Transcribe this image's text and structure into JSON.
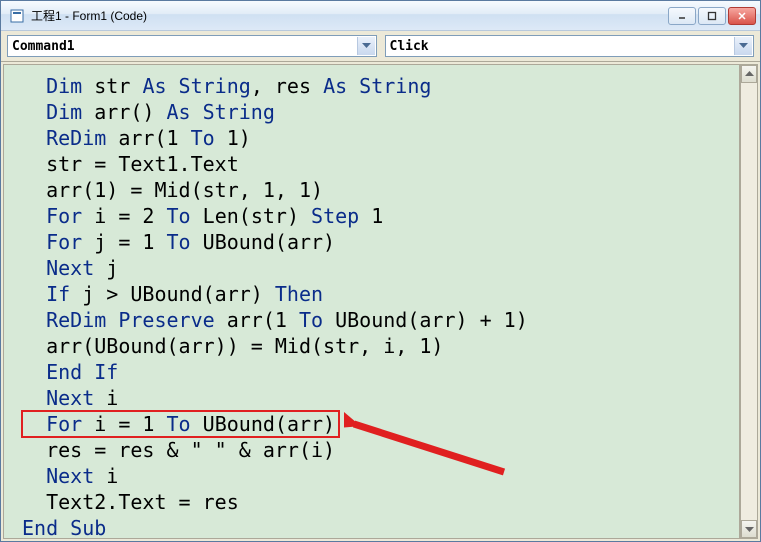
{
  "window": {
    "title": "工程1 - Form1 (Code)"
  },
  "dropdowns": {
    "object_selector": "Command1",
    "event_selector": "Click"
  },
  "code": {
    "indent": "  ",
    "lines": [
      [
        [
          "kw",
          "Dim"
        ],
        [
          "tx",
          " str "
        ],
        [
          "kw",
          "As String"
        ],
        [
          "tx",
          ", res "
        ],
        [
          "kw",
          "As String"
        ]
      ],
      [
        [
          "kw",
          "Dim"
        ],
        [
          "tx",
          " arr() "
        ],
        [
          "kw",
          "As String"
        ]
      ],
      [
        [
          "kw",
          "ReDim"
        ],
        [
          "tx",
          " arr(1 "
        ],
        [
          "kw",
          "To"
        ],
        [
          "tx",
          " 1)"
        ]
      ],
      [
        [
          "tx",
          "str = Text1.Text"
        ]
      ],
      [
        [
          "tx",
          "arr(1) = Mid(str, 1, 1)"
        ]
      ],
      [
        [
          "kw",
          "For"
        ],
        [
          "tx",
          " i = 2 "
        ],
        [
          "kw",
          "To"
        ],
        [
          "tx",
          " Len(str) "
        ],
        [
          "kw",
          "Step"
        ],
        [
          "tx",
          " 1"
        ]
      ],
      [
        [
          "kw",
          "For"
        ],
        [
          "tx",
          " j = 1 "
        ],
        [
          "kw",
          "To"
        ],
        [
          "tx",
          " UBound(arr)"
        ]
      ],
      [
        [
          "kw",
          "Next"
        ],
        [
          "tx",
          " j"
        ]
      ],
      [
        [
          "kw",
          "If"
        ],
        [
          "tx",
          " j > UBound(arr) "
        ],
        [
          "kw",
          "Then"
        ]
      ],
      [
        [
          "kw",
          "ReDim Preserve"
        ],
        [
          "tx",
          " arr(1 "
        ],
        [
          "kw",
          "To"
        ],
        [
          "tx",
          " UBound(arr) + 1)"
        ]
      ],
      [
        [
          "tx",
          "arr(UBound(arr)) = Mid(str, i, 1)"
        ]
      ],
      [
        [
          "kw",
          "End If"
        ]
      ],
      [
        [
          "kw",
          "Next"
        ],
        [
          "tx",
          " i"
        ]
      ],
      [
        [
          "kw",
          "For"
        ],
        [
          "tx",
          " i = 1 "
        ],
        [
          "kw",
          "To"
        ],
        [
          "tx",
          " UBound(arr)"
        ]
      ],
      [
        [
          "tx",
          "res = res & \" \" & arr(i)"
        ]
      ],
      [
        [
          "kw",
          "Next"
        ],
        [
          "tx",
          " i"
        ]
      ],
      [
        [
          "tx",
          "Text2.Text = res"
        ]
      ]
    ],
    "end_line": [
      [
        "kw",
        "End Sub"
      ]
    ]
  },
  "highlight": {
    "line_index": 13
  }
}
